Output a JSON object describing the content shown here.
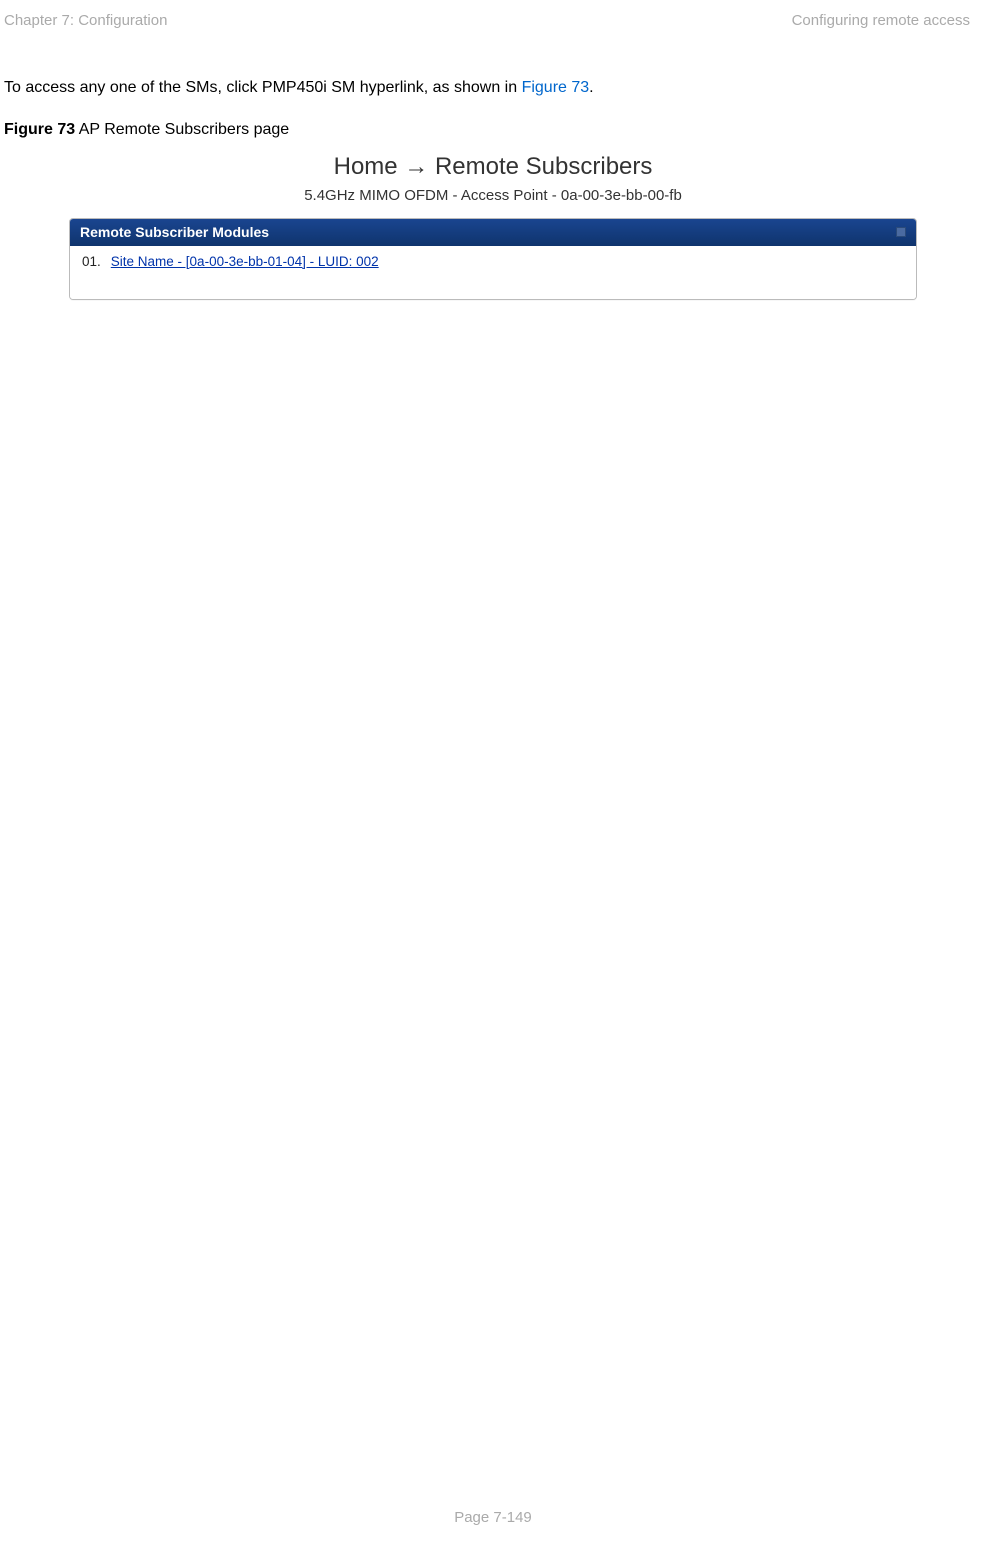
{
  "header": {
    "chapter": "Chapter 7:  Configuration",
    "section": "Configuring remote access"
  },
  "intro": {
    "text_before_link": "To access any one of the SMs, click PMP450i SM hyperlink, as shown in ",
    "link_text": "Figure 73",
    "text_after_link": "."
  },
  "figure": {
    "label": "Figure 73",
    "caption": " AP Remote Subscribers page"
  },
  "breadcrumb": "Home → Remote Subscribers",
  "device_subtitle": "5.4GHz MIMO OFDM - Access Point - 0a-00-3e-bb-00-fb",
  "panel": {
    "title": "Remote Subscriber Modules",
    "entries": [
      {
        "number": "01.",
        "link": "Site Name - [0a-00-3e-bb-01-04] - LUID: 002"
      }
    ]
  },
  "footer": {
    "page": "Page 7-149"
  }
}
